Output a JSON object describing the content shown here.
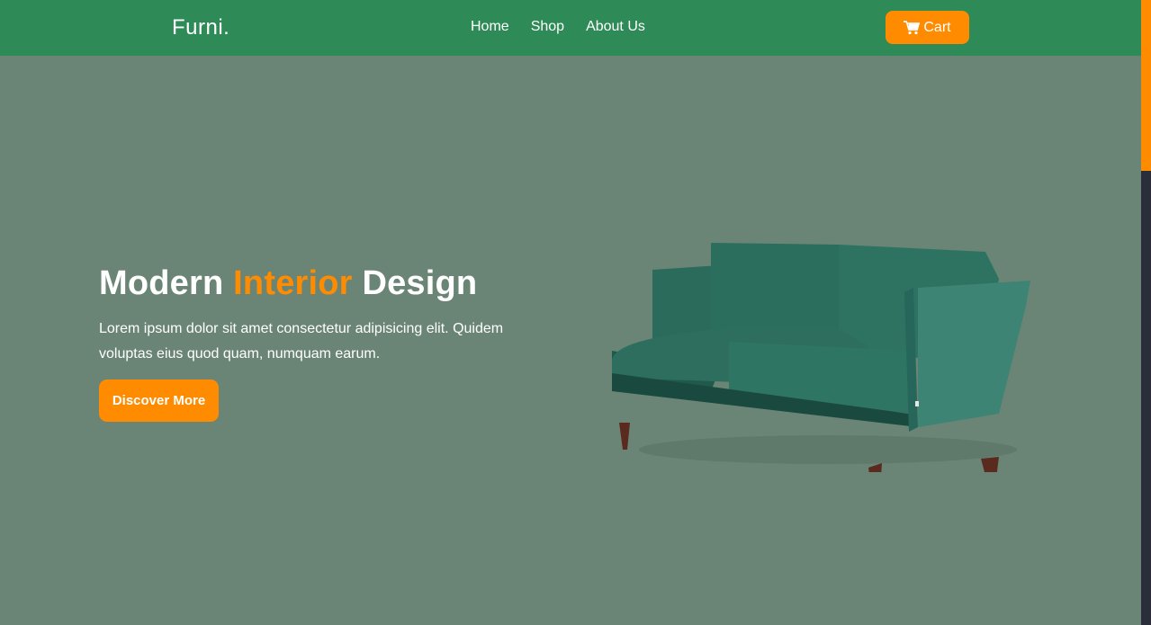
{
  "brand": {
    "name": "Furni."
  },
  "nav": {
    "links": [
      {
        "label": "Home"
      },
      {
        "label": "Shop"
      },
      {
        "label": "About Us"
      }
    ],
    "cart_label": "Cart"
  },
  "hero": {
    "title_part1": "Modern ",
    "title_accent": "Interior",
    "title_part2": " Design",
    "description": "Lorem ipsum dolor sit amet consectetur adipisicing elit. Quidem voluptas eius quod quam, numquam earum.",
    "button_label": "Discover More",
    "image_icon": "sofa-image"
  },
  "colors": {
    "navbar_bg": "#2e8a57",
    "hero_bg": "#6a8575",
    "accent": "#ff8c00",
    "scrollbar_track": "#2a2d3a"
  }
}
